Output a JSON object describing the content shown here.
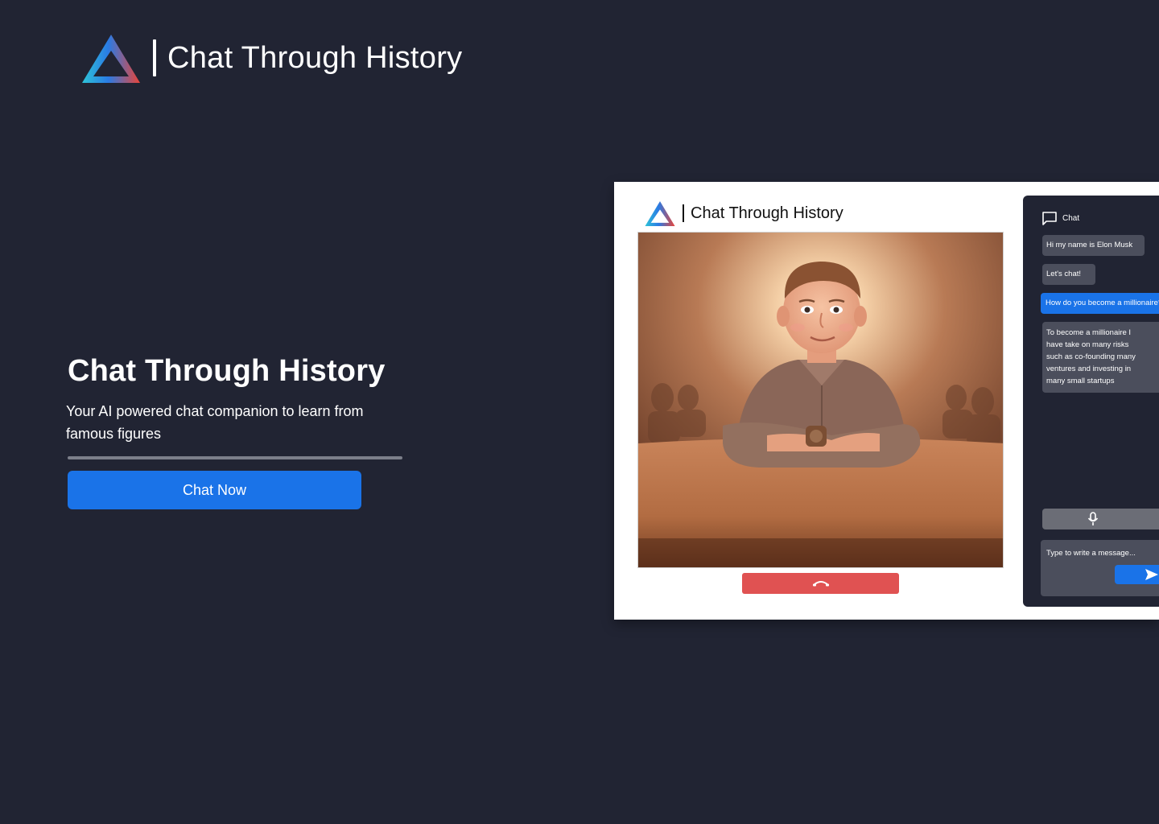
{
  "header": {
    "title": "Chat Through History"
  },
  "hero": {
    "title": "Chat Through History",
    "subtitle": "Your AI powered chat companion to learn from famous figures",
    "cta_label": "Chat Now"
  },
  "preview": {
    "title": "Chat Through History",
    "chat": {
      "heading": "Chat",
      "messages": [
        {
          "from": "bot",
          "text": "Hi my name is Elon Musk"
        },
        {
          "from": "bot",
          "text": "Let's chat!"
        },
        {
          "from": "user",
          "text": "How do you become a millionaire?"
        },
        {
          "from": "bot",
          "lines": [
            "To become a millionaire I",
            "have take on many risks",
            "such as co-founding many",
            "ventures and investing in",
            "many small startups"
          ]
        }
      ],
      "input_placeholder": "Type to write a message..."
    }
  },
  "icons": {
    "logo": "triangle-logo-icon",
    "chat": "chat-bubble-icon",
    "mic": "microphone-icon",
    "send": "send-icon",
    "hangup": "phone-hangup-icon"
  },
  "colors": {
    "background": "#212433",
    "accent": "#1a73e8",
    "hangup": "#e05252",
    "bot_bubble": "#4b4e5c",
    "mic_bar": "#6b6d76"
  }
}
